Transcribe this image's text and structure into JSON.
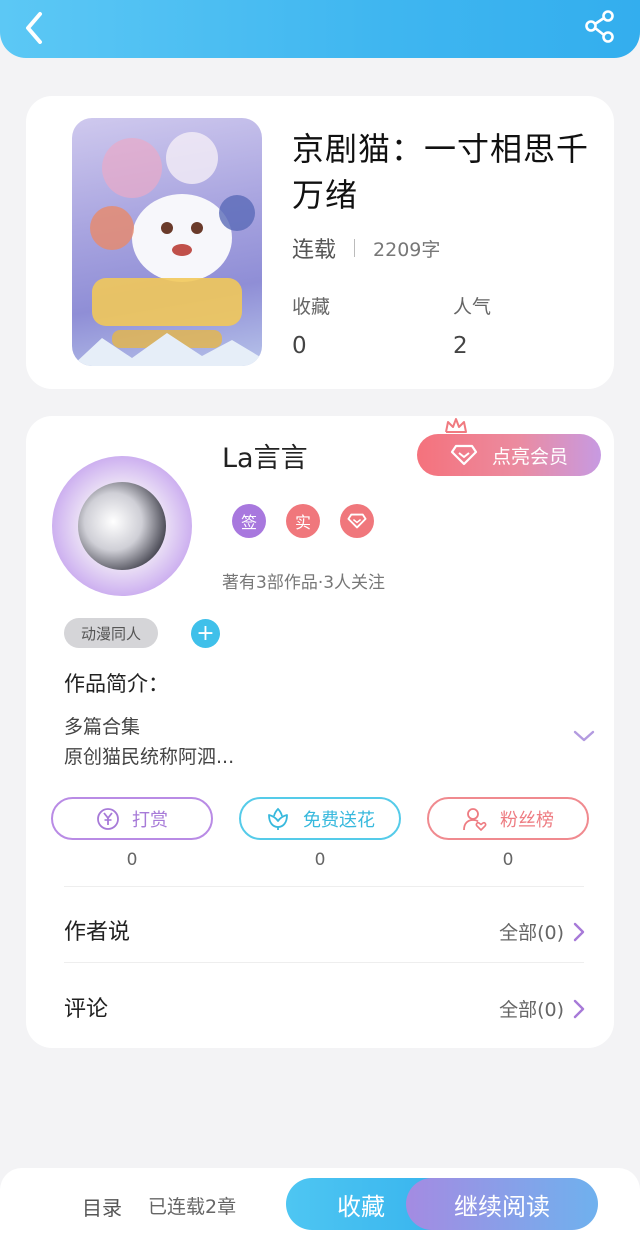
{
  "header": {
    "back_icon": "chevron-left-icon",
    "share_icon": "share-icon",
    "gradient_start": "#5cc8f5",
    "gradient_end": "#33aeee"
  },
  "book": {
    "title": "京剧猫：一寸相思千万绪",
    "status": "连载",
    "word_count": "2209字",
    "stats": [
      {
        "label": "收藏",
        "value": "0"
      },
      {
        "label": "人气",
        "value": "2"
      }
    ]
  },
  "author": {
    "name": "La言言",
    "vip_button": "点亮会员",
    "badges": [
      "签",
      "实"
    ],
    "meta": "著有3部作品·3人关注",
    "tag": "动漫同人",
    "intro_title": "作品简介：",
    "intro_lines": [
      "多篇合集",
      "原创猫民统称阿泗..."
    ]
  },
  "actions": [
    {
      "label": "打赏",
      "icon": "yen-icon",
      "count": "0",
      "color": "#a77ad8"
    },
    {
      "label": "免费送花",
      "icon": "flower-icon",
      "count": "0",
      "color": "#38b9dd"
    },
    {
      "label": "粉丝榜",
      "icon": "fan-rank-icon",
      "count": "0",
      "color": "#ee7c82"
    }
  ],
  "rows": [
    {
      "title": "作者说",
      "right": "全部(0)"
    },
    {
      "title": "评论",
      "right": "全部(0)"
    }
  ],
  "bottom_bar": {
    "toc": "目录",
    "chapters": "已连载2章",
    "collect": "收藏",
    "read": "继续阅读"
  }
}
